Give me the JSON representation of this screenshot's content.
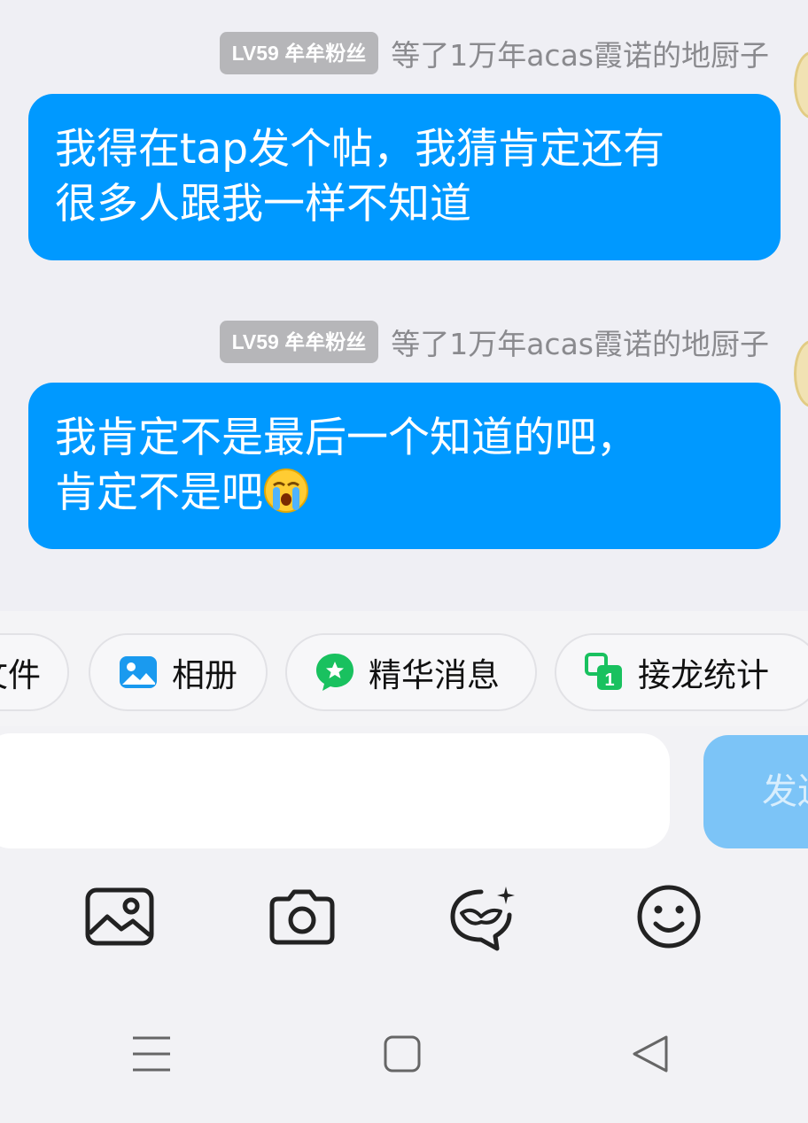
{
  "messages": [
    {
      "badge": "LV59 牟牟粉丝",
      "nickname": "等了1万年acas霞诺的地厨子",
      "line1": "我得在tap发个帖，我猜肯定还有",
      "line2": "很多人跟我一样不知道"
    },
    {
      "badge": "LV59 牟牟粉丝",
      "nickname": "等了1万年acas霞诺的地厨子",
      "line1": "我肯定不是最后一个知道的吧，",
      "line2": "肯定不是吧",
      "emoji": "crying-face-icon"
    }
  ],
  "chips": [
    {
      "label": "文件",
      "icon": "file-icon"
    },
    {
      "label": "相册",
      "icon": "album-icon"
    },
    {
      "label": "精华消息",
      "icon": "essence-message-icon"
    },
    {
      "label": "接龙统计",
      "icon": "chain-stats-icon"
    }
  ],
  "input": {
    "value": ""
  },
  "send_label": "发送",
  "toolbar": [
    "image-icon",
    "camera-icon",
    "sticker-icon",
    "emoji-icon"
  ],
  "navbar": [
    "menu-icon",
    "home-icon",
    "back-icon"
  ],
  "colors": {
    "bubble": "#0099ff",
    "badge": "#b6b6b9",
    "send_disabled": "#7cc4f7",
    "essence_green": "#19c15f",
    "album_blue": "#1a9aef"
  }
}
